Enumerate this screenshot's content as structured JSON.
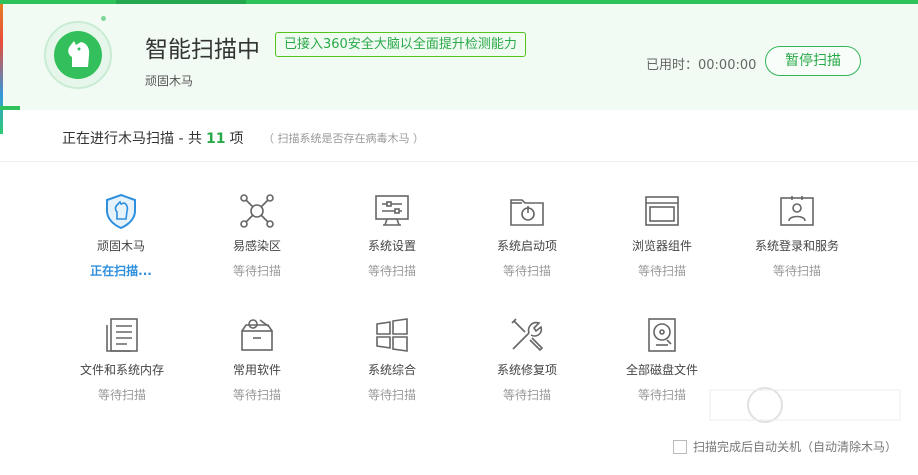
{
  "header": {
    "title": "智能扫描中",
    "badge": "已接入360安全大脑以全面提升检测能力",
    "subtitle": "顽固木马",
    "elapsed": "已用时：00:00:00",
    "pause_label": "暂停扫描",
    "progress_fraction": 0.02
  },
  "section": {
    "title_prefix": "正在进行木马扫描 - 共",
    "count": "11",
    "title_suffix": "项",
    "hint": "（ 扫描系统是否存在病毒木马 ）"
  },
  "items": [
    {
      "label": "顽固木马",
      "status": "正在扫描...",
      "icon": "shield-horse-icon"
    },
    {
      "label": "易感染区",
      "status": "等待扫描",
      "icon": "network-nodes-icon"
    },
    {
      "label": "系统设置",
      "status": "等待扫描",
      "icon": "monitor-settings-icon"
    },
    {
      "label": "系统启动项",
      "status": "等待扫描",
      "icon": "folder-power-icon"
    },
    {
      "label": "浏览器组件",
      "status": "等待扫描",
      "icon": "browser-window-icon"
    },
    {
      "label": "系统登录和服务",
      "status": "等待扫描",
      "icon": "user-card-icon"
    },
    {
      "label": "文件和系统内存",
      "status": "等待扫描",
      "icon": "document-icon"
    },
    {
      "label": "常用软件",
      "status": "等待扫描",
      "icon": "software-box-icon"
    },
    {
      "label": "系统综合",
      "status": "等待扫描",
      "icon": "windows-logo-icon"
    },
    {
      "label": "系统修复项",
      "status": "等待扫描",
      "icon": "wrench-tools-icon"
    },
    {
      "label": "全部磁盘文件",
      "status": "等待扫描",
      "icon": "hard-disk-icon"
    }
  ],
  "footer": {
    "shutdown_label": "扫描完成后自动关机（自动清除木马）"
  },
  "colors": {
    "accent": "#2fc25b",
    "active_status": "#2e8fdd"
  }
}
